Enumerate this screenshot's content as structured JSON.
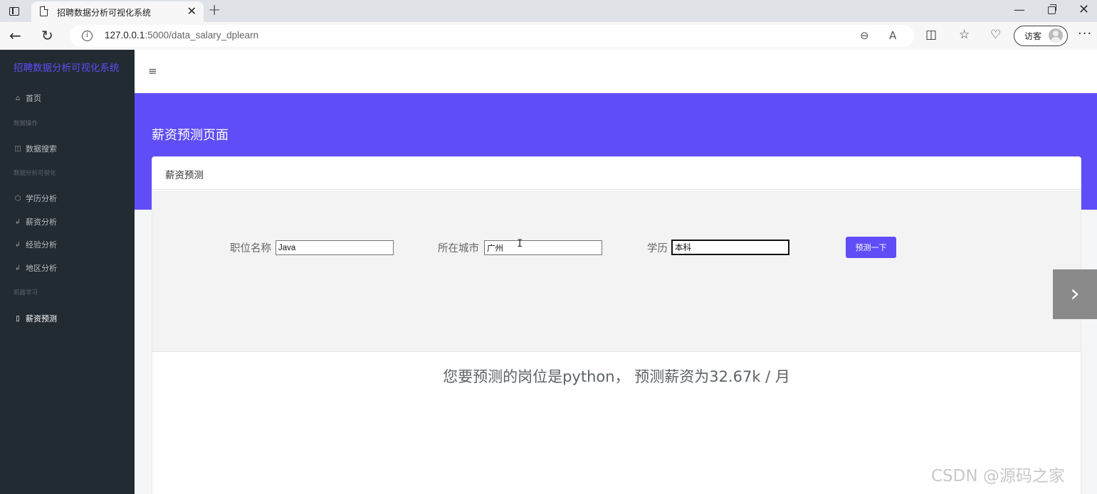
{
  "browser": {
    "tab_title": "招聘数据分析可视化系统",
    "url_host": "127.0.0.1",
    "url_path": ":5000/data_salary_dplearn",
    "guest_label": "访客"
  },
  "sidebar": {
    "brand": "招聘数据分析可视化系统",
    "items": [
      {
        "label": "首页",
        "icon": "home-icon"
      },
      {
        "heading": "数据操作"
      },
      {
        "label": "数据搜索",
        "icon": "table-icon"
      },
      {
        "heading": "数据分析可视化"
      },
      {
        "label": "学历分析",
        "icon": "cube-icon"
      },
      {
        "label": "薪资分析",
        "icon": "chart-icon"
      },
      {
        "label": "经验分析",
        "icon": "chart-icon"
      },
      {
        "label": "地区分析",
        "icon": "chart-icon"
      },
      {
        "heading": "机器学习"
      },
      {
        "label": "薪资预测",
        "icon": "clipboard-icon",
        "active": true
      }
    ]
  },
  "page": {
    "banner_title": "薪资预测页面",
    "card_title": "薪资预测",
    "form": {
      "job_label": "职位名称",
      "job_value": "Java",
      "city_label": "所在城市",
      "city_value": "广州",
      "edu_label": "学历",
      "edu_value": "本科",
      "submit_label": "预测一下"
    },
    "result": "您要预测的岗位是python， 预测薪资为32.67k / 月"
  },
  "watermark": "CSDN @源码之家",
  "colors": {
    "accent": "#5f4df7",
    "sidebar_bg": "#232b32"
  }
}
